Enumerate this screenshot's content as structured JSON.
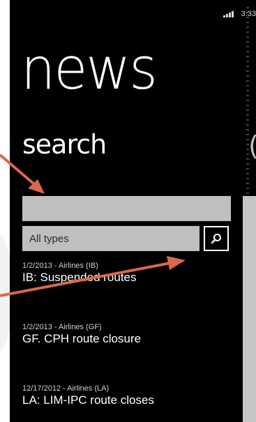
{
  "status_bar": {
    "time": "3:33",
    "signal_icon": "signal-icon"
  },
  "app": {
    "title": "news",
    "pivot_header": "search",
    "next_pivot_glyph": "("
  },
  "search": {
    "input_value": "",
    "type_select_value": "All types",
    "search_button_icon": "magnifier-icon"
  },
  "news_items": [
    {
      "meta": "1/2/2013 - Airlines (IB)",
      "title": "IB: Suspended routes"
    },
    {
      "meta": "1/2/2013 - Airlines (GF)",
      "title": "GF. CPH route closure"
    },
    {
      "meta": "12/17/2012 - Airlines (LA)",
      "title": "LA: LIM-IPC route closes"
    }
  ],
  "annotations": {
    "arrow_color": "#d9674c"
  },
  "colors": {
    "phone_background": "#000000",
    "input_background": "#bfbfbf",
    "text": "#ffffff"
  }
}
